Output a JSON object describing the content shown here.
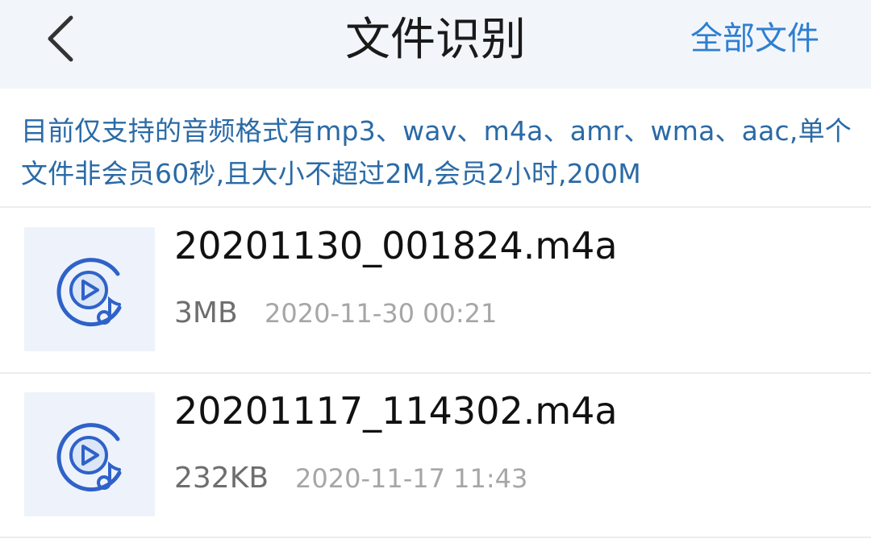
{
  "header": {
    "title": "文件识别",
    "right_action": "全部文件"
  },
  "notice": "目前仅支持的音频格式有mp3、wav、m4a、amr、wma、aac,单个文件非会员60秒,且大小不超过2M,会员2小时,200M",
  "files": [
    {
      "name": "20201130_001824.m4a",
      "size": "3MB",
      "date": "2020-11-30 00:21"
    },
    {
      "name": "20201117_114302.m4a",
      "size": "232KB",
      "date": "2020-11-17 11:43"
    }
  ],
  "icons": {
    "back": "chevron-left-icon",
    "file": "audio-file-icon"
  },
  "colors": {
    "header_bg": "#f2f6fb",
    "accent": "#2f7fd1",
    "notice_text": "#2a6aa6",
    "icon_blue": "#2f62c9"
  }
}
